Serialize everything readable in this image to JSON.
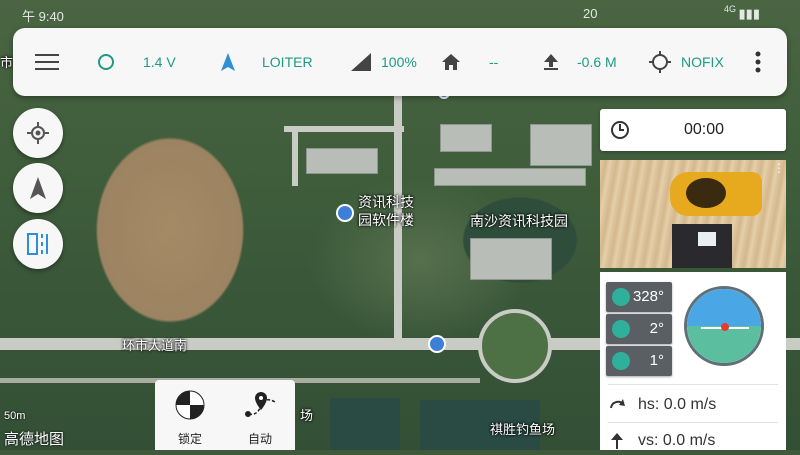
{
  "statusbar": {
    "time": "午 9:40",
    "date_fragment": "20",
    "network": "4G"
  },
  "toolbar": {
    "menu_icon": "hamburger-menu-icon",
    "battery_icon": "circle-icon",
    "battery_voltage": "1.4 V",
    "mode_icon": "navigation-arrow-icon",
    "flight_mode": "LOITER",
    "signal_icon": "signal-strength-icon",
    "signal_strength": "100%",
    "home_icon": "home-icon",
    "home_distance": "--",
    "altitude_icon": "upload-arrow-icon",
    "altitude": "-0.6 M",
    "gps_icon": "gps-target-icon",
    "gps_status": "NOFIX"
  },
  "left_controls": [
    "locate-me-icon",
    "compass-arrow-icon",
    "split-view-icon"
  ],
  "timer": {
    "value": "00:00"
  },
  "attitude": {
    "yaw": "328°",
    "pitch": "2°",
    "roll": "1°",
    "horizontal_speed": "hs: 0.0 m/s",
    "vertical_speed": "vs: 0.0 m/s"
  },
  "actions": {
    "lock_label": "锁定",
    "auto_label": "自动"
  },
  "map": {
    "label_building": "资讯科技\n园软件楼",
    "label_park": "南沙资讯科技园",
    "label_road": "环市大道南",
    "label_fish": "祺胜钓鱼场",
    "label_fish_partial": "场",
    "label_left_partial": "市",
    "provider": "高德地图",
    "scale": "50m"
  },
  "colors": {
    "accent": "#1e9a83",
    "panel": "#f6f7f6"
  }
}
